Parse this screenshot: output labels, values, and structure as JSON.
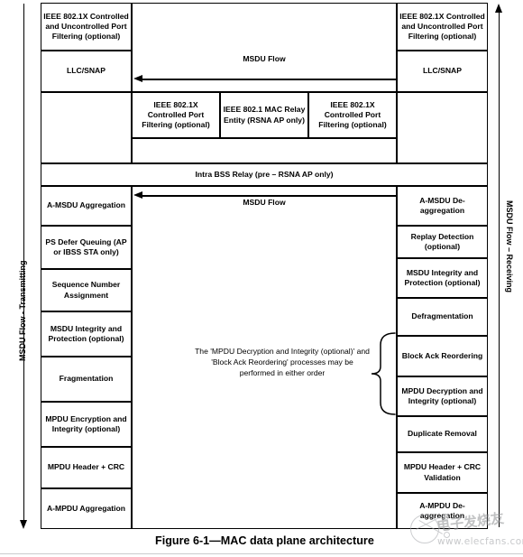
{
  "figure": {
    "caption": "Figure 6-1—MAC data plane architecture"
  },
  "side_labels": {
    "left": "MSDU Flow - Transmitting",
    "right": "MSDU Flow – Receiving"
  },
  "top_section": {
    "left_port_filter": "IEEE 802.1X Controlled and Uncontrolled Port Filtering (optional)",
    "left_llc": "LLC/SNAP",
    "right_port_filter": "IEEE 802.1X Controlled and Uncontrolled Port Filtering (optional)",
    "right_llc": "LLC/SNAP",
    "msdu_flow_label_line1": "MSDU",
    "msdu_flow_label_line2": "Flow",
    "relay_boxes": [
      "IEEE 802.1X Controlled Port Filtering (optional)",
      "IEEE 802.1 MAC Relay Entity (RSNA AP only)",
      "IEEE 802.1X Controlled Port Filtering (optional)"
    ],
    "intra_bss_relay": "Intra BSS Relay (pre – RSNA AP only)"
  },
  "mid_section": {
    "msdu_flow_label_line1": "MSDU",
    "msdu_flow_label_line2": "Flow"
  },
  "transmit_column": {
    "items": [
      "A-MSDU Aggregation",
      "PS Defer Queuing (AP or IBSS STA only)",
      "Sequence Number Assignment",
      "MSDU Integrity and Protection (optional)",
      "Fragmentation",
      "MPDU Encryption and Integrity (optional)",
      "MPDU Header + CRC",
      "A-MPDU Aggregation"
    ]
  },
  "receive_column": {
    "items": [
      "A-MSDU De-aggregation",
      "Replay Detection (optional)",
      "MSDU Integrity and Protection (optional)",
      "Defragmentation",
      "Block Ack Reordering",
      "MPDU Decryption and Integrity (optional)",
      "Duplicate Removal",
      "MPDU Header + CRC Validation",
      "A-MPDU De-aggregation"
    ]
  },
  "annotation": {
    "text": "The 'MPDU Decryption and Integrity (optional)' and 'Block Ack Reordering' processes may be performed in either order"
  },
  "watermark": {
    "chinese": "电子发烧友",
    "url": "www.elecfans.com"
  },
  "colors": {
    "stroke": "#000000",
    "background": "#ffffff",
    "watermark": "#9a9ca0"
  }
}
